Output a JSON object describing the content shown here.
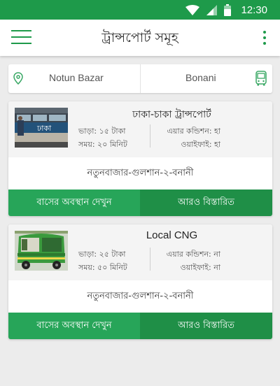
{
  "status_bar": {
    "time": "12:30",
    "icons": [
      "wifi-icon",
      "signal-icon",
      "battery-icon"
    ]
  },
  "app_bar": {
    "title": "ট্রান্সপোর্ট সমূহ",
    "menu_icon": "hamburger-menu-icon",
    "more_icon": "more-vertical-icon"
  },
  "route": {
    "from": "Notun Bazar",
    "to": "Bonani",
    "from_icon": "location-pin-icon",
    "to_icon": "bus-icon"
  },
  "transports": [
    {
      "name": "ঢাকা-চাকা ট্রান্সপোর্ট",
      "image_text": "ঢাকা",
      "fare": "ভাড়া: ১৫ টাকা",
      "time": "সময়: ২০ মিনিট",
      "ac": "এয়ার কন্ডিশন: হা",
      "wifi": "ওয়াইফাই: হা",
      "route": "নতুনবাজার-গুলশান-২-বনানী",
      "location_btn": "বাসের অবস্থান দেখুন",
      "details_btn": "আরও বিস্তারিত"
    },
    {
      "name": "Local CNG",
      "fare": "ভাড়া: ২৫ টাকা",
      "time": "সময়: ৫০ মিনিট",
      "ac": "এয়ার কন্ডিশন: না",
      "wifi": "ওয়াইফাই: না",
      "route": "নতুনবাজার-গুলশান-২-বনানী",
      "location_btn": "বাসের অবস্থান দেখুন",
      "details_btn": "আরও বিস্তারিত"
    }
  ],
  "colors": {
    "primary": "#1e9a4a",
    "button_light": "#27a559",
    "button_dark": "#1f8f47",
    "background": "#ececec"
  }
}
